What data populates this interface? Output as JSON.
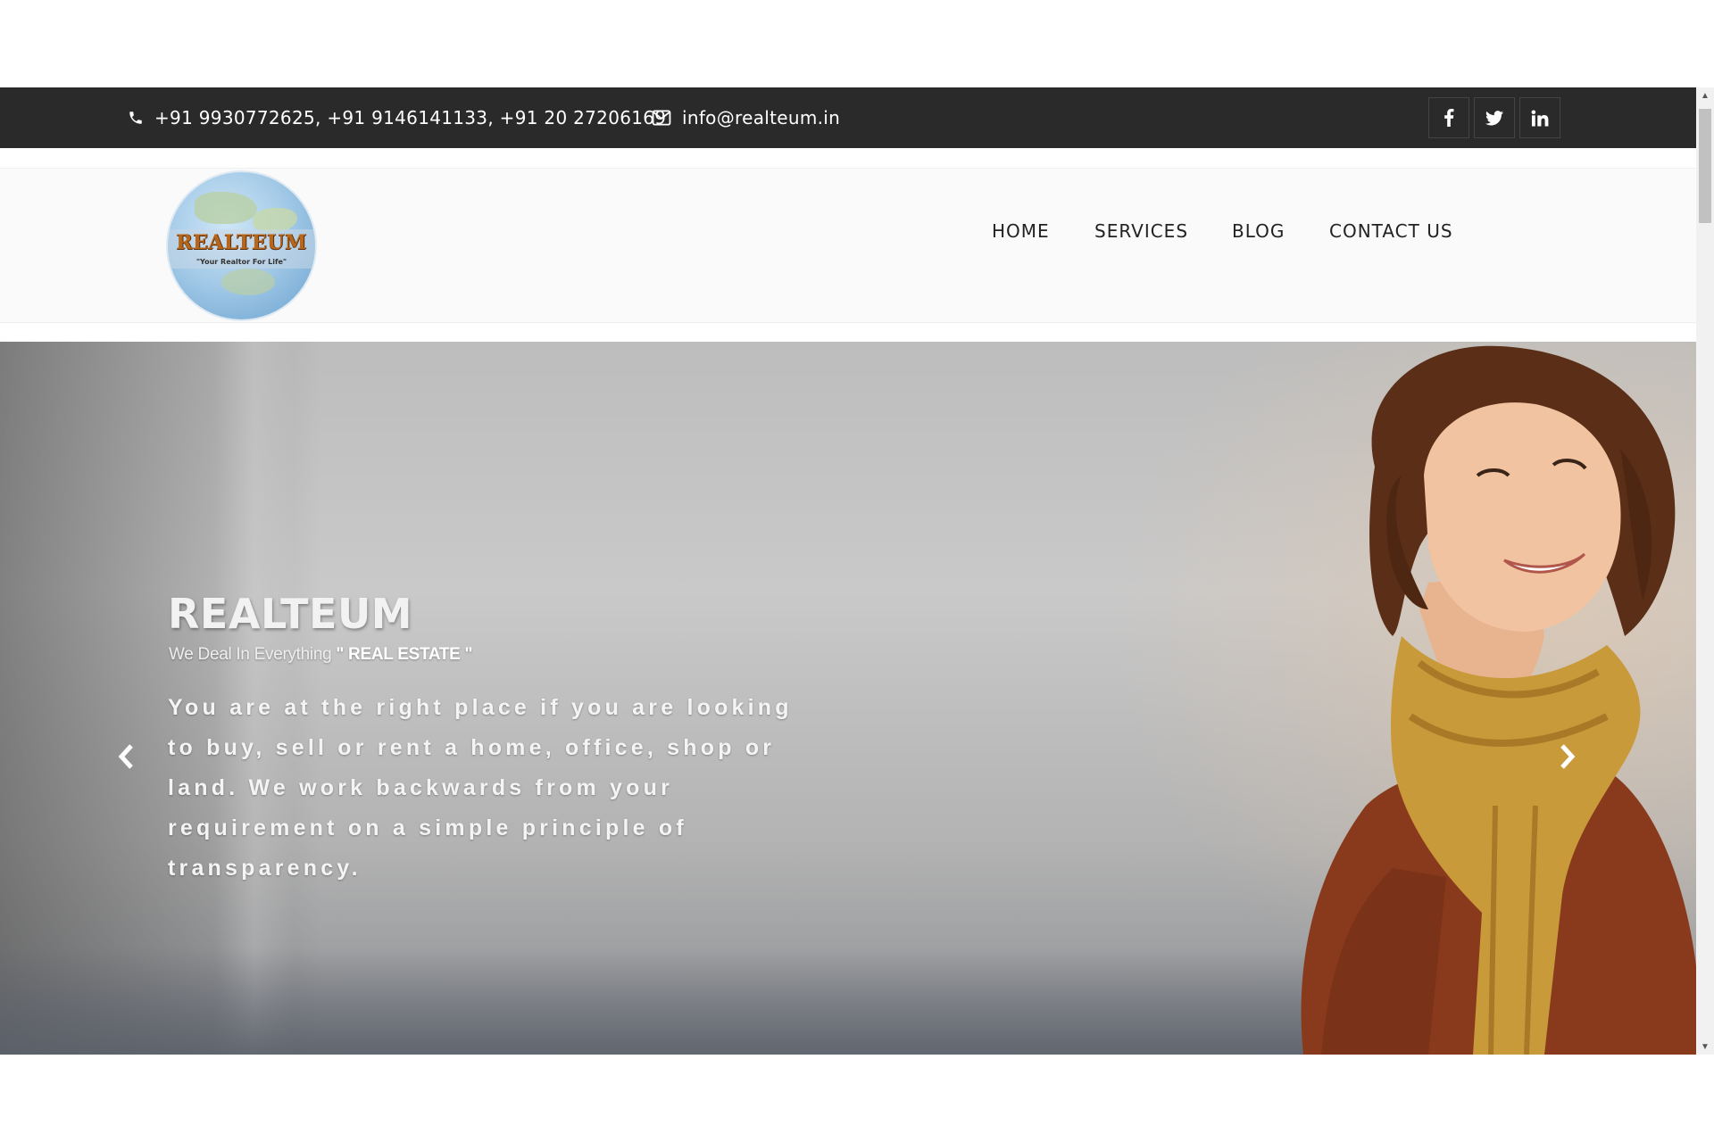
{
  "topbar": {
    "phone": "+91 9930772625, +91 9146141133, +91 20 27206169",
    "email": "info@realteum.in",
    "social": [
      {
        "label": "f",
        "icon": "facebook-icon"
      },
      {
        "label": "twitter",
        "icon": "twitter-icon"
      },
      {
        "label": "in",
        "icon": "linkedin-icon"
      }
    ]
  },
  "logo": {
    "name": "REALTEUM",
    "tagline": "\"Your Realtor For Life\""
  },
  "nav": {
    "items": [
      "HOME",
      "SERVICES",
      "BLOG",
      "CONTACT US"
    ]
  },
  "hero": {
    "title": "REALTEUM",
    "subtitle_prefix": "We Deal In Everything",
    "subtitle_highlight": "\" REAL ESTATE \"",
    "description": "You are at the right place if you are looking to buy, sell or rent a home, office, shop or land. We work backwards from your requirement on a simple principle of transparency.",
    "prev_icon": "chevron-left-icon",
    "next_icon": "chevron-right-icon"
  },
  "colors": {
    "topbar_bg": "#2a2a2a",
    "header_bg": "#fafafa",
    "logo_text": "#b8661b"
  }
}
